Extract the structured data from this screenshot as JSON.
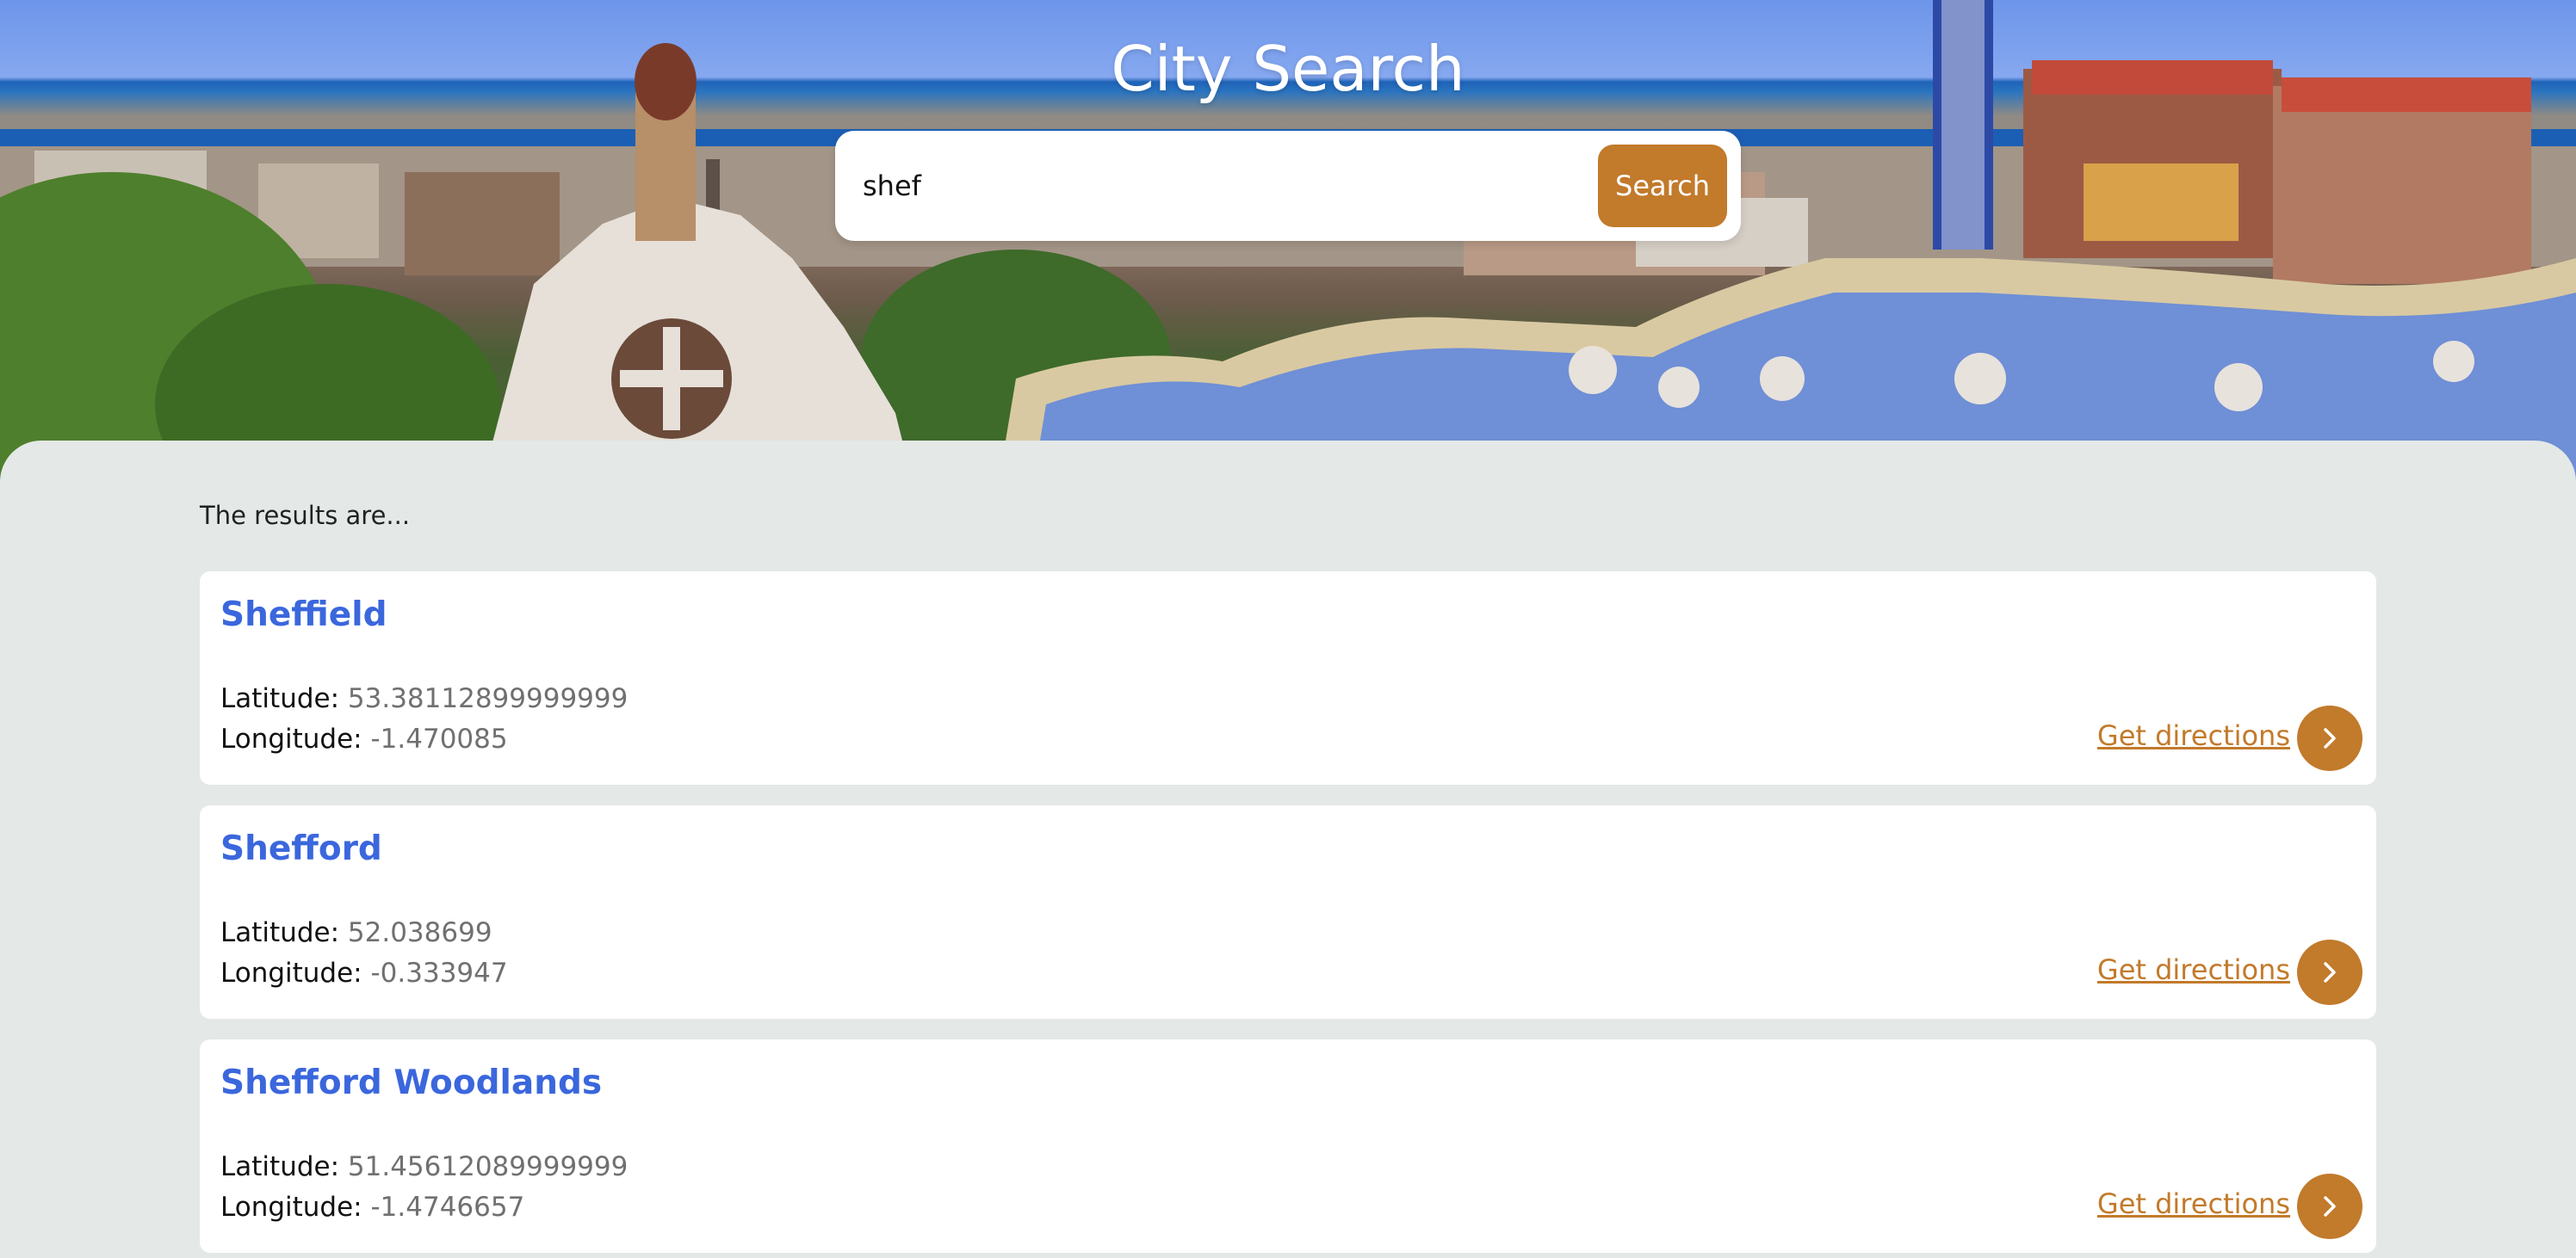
{
  "header": {
    "title": "City Search"
  },
  "search": {
    "value": "shef",
    "button_label": "Search"
  },
  "results": {
    "intro": "The results are...",
    "lat_label": "Latitude:",
    "lon_label": "Longitude:",
    "directions_label": "Get directions",
    "items": [
      {
        "name": "Sheffield",
        "latitude": "53.38112899999999",
        "longitude": "-1.470085"
      },
      {
        "name": "Shefford",
        "latitude": "52.038699",
        "longitude": "-0.333947"
      },
      {
        "name": "Shefford Woodlands",
        "latitude": "51.45612089999999",
        "longitude": "-1.4746657"
      }
    ]
  },
  "colors": {
    "accent": "#c27a2b",
    "city_name": "#3b67dd",
    "panel_background": "#e4e8e6"
  },
  "icons": {
    "arrow": "chevron-right-icon"
  }
}
